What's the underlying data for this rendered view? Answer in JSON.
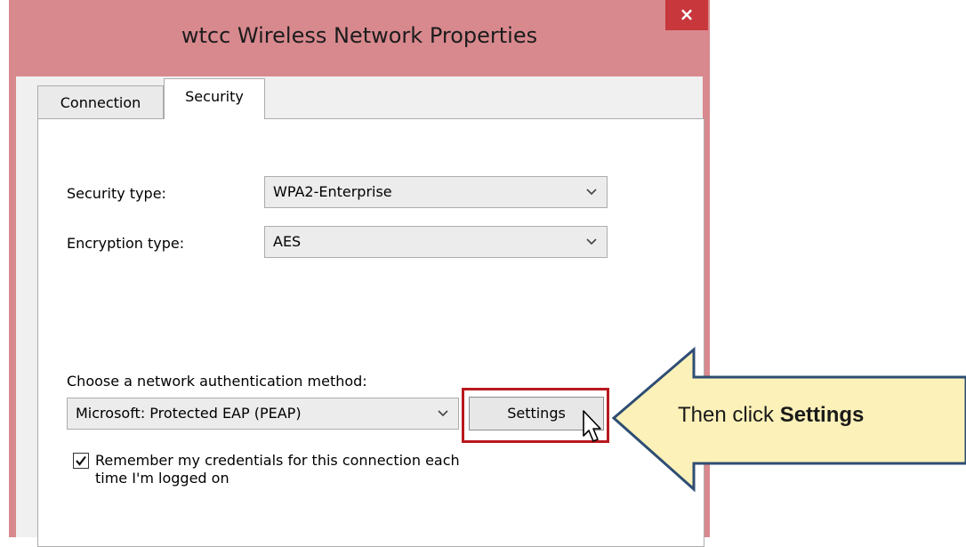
{
  "window": {
    "title": "wtcc Wireless Network Properties",
    "close_glyph": "×"
  },
  "tabs": [
    {
      "label": "Connection"
    },
    {
      "label": "Security"
    }
  ],
  "security": {
    "security_type_label": "Security type:",
    "security_type_value": "WPA2-Enterprise",
    "encryption_type_label": "Encryption type:",
    "encryption_type_value": "AES",
    "auth_method_label": "Choose a network authentication method:",
    "auth_method_value": "Microsoft: Protected EAP (PEAP)",
    "settings_button": "Settings",
    "remember_line1": "Remember my credentials for this connection each",
    "remember_line2": "time I'm logged on",
    "remember_checked": true
  },
  "callout": {
    "prefix": "Then click ",
    "bold": "Settings",
    "fill_color": "#fcf1b8",
    "stroke_color": "#2e4d73"
  },
  "colors": {
    "window_frame": "#d8898e",
    "close_button": "#c7373b",
    "highlight_border": "#b8191e"
  }
}
